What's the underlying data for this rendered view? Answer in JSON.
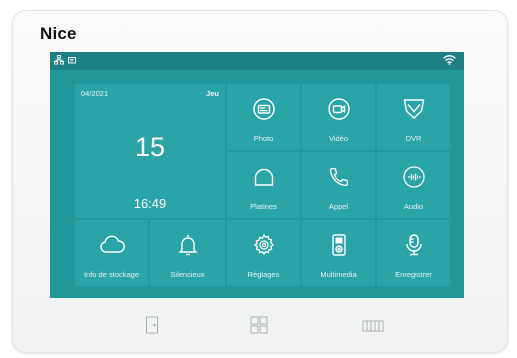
{
  "device": {
    "brand": "Nice"
  },
  "status_bar": {
    "left_icons": [
      "network-icon",
      "message-icon"
    ],
    "right_icons": [
      "wifi-icon"
    ]
  },
  "clock": {
    "date": "04/2021",
    "weekday": "Jeu",
    "day": "15",
    "time": "16:49"
  },
  "tiles": {
    "photo": {
      "label": "Photo",
      "icon": "photo-icon"
    },
    "video": {
      "label": "Vidéo",
      "icon": "video-icon"
    },
    "dvr": {
      "label": "DVR",
      "icon": "shield-icon"
    },
    "platines": {
      "label": "Platines",
      "icon": "bell-outline-icon"
    },
    "appel": {
      "label": "Appel",
      "icon": "phone-icon"
    },
    "audio": {
      "label": "Audio",
      "icon": "audio-wave-icon"
    },
    "stockage": {
      "label": "Info de stockage",
      "icon": "cloud-icon"
    },
    "silencieux": {
      "label": "Silencieux",
      "icon": "bell-icon"
    },
    "reglages": {
      "label": "Réglages",
      "icon": "gear-icon"
    },
    "multimedia": {
      "label": "Multimedia",
      "icon": "media-player-icon"
    },
    "enregistrer": {
      "label": "Enregistrer",
      "icon": "microphone-icon"
    }
  },
  "hardware_buttons": [
    "door-icon",
    "home-grid-icon",
    "gate-icon"
  ],
  "colors": {
    "screen_bg": "#23989b",
    "tile_bg": "#2ba4a7",
    "status_bar": "#1e7f84",
    "bezel": "#f6f7f7"
  }
}
